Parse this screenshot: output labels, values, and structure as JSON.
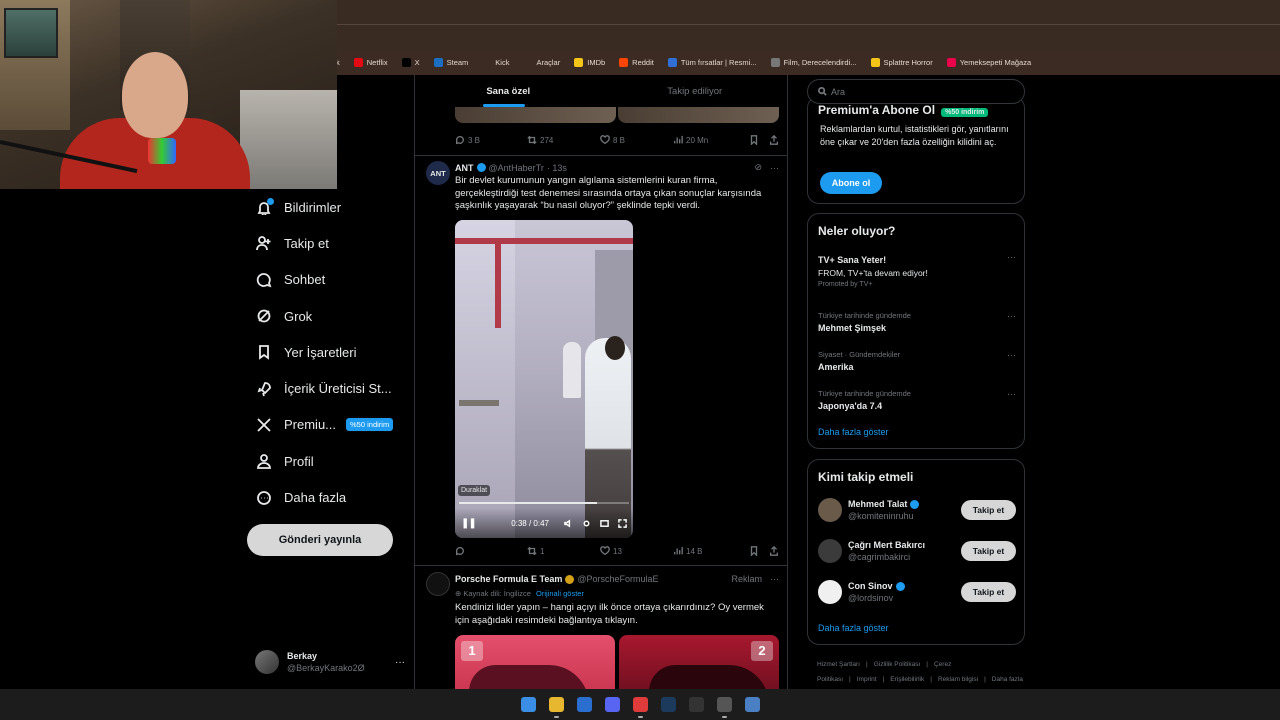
{
  "bookmarks": [
    {
      "label": "k",
      "icon": "bookmark-icon",
      "color": "#3b2b22"
    },
    {
      "label": "Netflix",
      "icon": "netflix-icon",
      "color": "#e50914"
    },
    {
      "label": "X",
      "icon": "x-icon",
      "color": "#000000"
    },
    {
      "label": "Steam",
      "icon": "steam-icon",
      "color": "#1b6ec2"
    },
    {
      "label": "Kick",
      "icon": "folder-icon",
      "color": "#3b2b22"
    },
    {
      "label": "Araçlar",
      "icon": "folder-icon",
      "color": "#3b2b22"
    },
    {
      "label": "IMDb",
      "icon": "imdb-icon",
      "color": "#f5c518"
    },
    {
      "label": "Reddit",
      "icon": "reddit-icon",
      "color": "#ff4500"
    },
    {
      "label": "Tüm fırsatlar | Resmi...",
      "icon": "store-icon",
      "color": "#2f6fd6"
    },
    {
      "label": "Film, Derecelendirdi...",
      "icon": "globe-icon",
      "color": "#777777"
    },
    {
      "label": "Splattre Horror",
      "icon": "folder-icon",
      "color": "#f5c518"
    },
    {
      "label": "Yemeksepeti Mağaza",
      "icon": "yemeksepeti-icon",
      "color": "#ea004b"
    }
  ],
  "nav": {
    "items": [
      {
        "label": "Bildirimler",
        "icon": "bell-icon"
      },
      {
        "label": "Takip et",
        "icon": "add-user-icon"
      },
      {
        "label": "Sohbet",
        "icon": "chat-icon"
      },
      {
        "label": "Grok",
        "icon": "grok-icon"
      },
      {
        "label": "Yer İşaretleri",
        "icon": "bookmark-icon"
      },
      {
        "label": "İçerik Üreticisi St...",
        "icon": "rocket-icon"
      },
      {
        "label": "Premiu...",
        "icon": "x-logo-icon",
        "badge": "%50 indirim"
      },
      {
        "label": "Profil",
        "icon": "person-icon"
      },
      {
        "label": "Daha fazla",
        "icon": "more-circle-icon"
      }
    ],
    "post_button": "Gönderi yayınla",
    "account": {
      "name": "Berkay",
      "handle": "@BerkayKarako2Ø",
      "more": "···"
    }
  },
  "tabs": [
    {
      "label": "Sana özel",
      "active": true
    },
    {
      "label": "Takip ediliyor",
      "active": false
    }
  ],
  "prev_tweet_actions": {
    "replies": "3 B",
    "reposts": "274",
    "likes": "8 B",
    "views": "20 Mn"
  },
  "tweet1": {
    "name": "ANT",
    "handle": "@AntHaberTr",
    "time": "· 13s",
    "avatar_text": "ANT",
    "text": "Bir devlet kurumunun yangın algılama sistemlerini kuran firma, gerçekleştirdiği test denemesi sırasında ortaya çıkan sonuçlar karşısında şaşkınlık yaşayarak “bu nasıl oluyor?” şeklinde tepki verdi.",
    "more": "···",
    "video": {
      "paused_label": "Duraklat",
      "time": "0:38 / 0:47",
      "progress": 0.81
    },
    "actions": {
      "replies": "",
      "reposts": "1",
      "likes": "13",
      "views": "14 B"
    }
  },
  "tweet2": {
    "name": "Porsche Formula E Team",
    "handle": "@PorscheFormulaE",
    "ad_label": "Reklam",
    "more": "···",
    "lang_note": "Kaynak dili: İngilizce",
    "lang_link": "Orijinali göster",
    "text": "Kendinizi lider yapın – hangi açıyı ilk önce ortaya çıkarırdınız? Oy vermek için aşağıdaki resimdeki bağlantıya tıklayın.",
    "images": [
      "1",
      "2"
    ]
  },
  "search": {
    "placeholder": "Ara"
  },
  "premium": {
    "title": "Premium'a Abone Ol",
    "badge": "%50 indirim",
    "text": "Reklamlardan kurtul, istatistikleri gör, yanıtlarını öne çıkar ve 20'den fazla özelliğin kilidini aç.",
    "button": "Abone ol"
  },
  "trends": {
    "title": "Neler oluyor?",
    "items": [
      {
        "category": "",
        "title": "TV+ Sana Yeter!",
        "sub": "FROM, TV+'ta devam ediyor!",
        "promo": "Promoted by TV+"
      },
      {
        "category": "Türkiye tarihinde gündemde",
        "title": "Mehmet Şimşek",
        "sub": "",
        "promo": ""
      },
      {
        "category": "Siyaset · Gündemdekiler",
        "title": "Amerika",
        "sub": "",
        "promo": ""
      },
      {
        "category": "Türkiye tarihinde gündemde",
        "title": "Japonya'da 7.4",
        "sub": "",
        "promo": ""
      }
    ],
    "more_icon": "···",
    "show_more": "Daha fazla göster"
  },
  "who_to_follow": {
    "title": "Kimi takip etmeli",
    "items": [
      {
        "name": "Mehmed Talat",
        "handle": "@komiteninruhu",
        "verified": true,
        "button": "Takip et"
      },
      {
        "name": "Çağrı Mert Bakırcı",
        "handle": "@cagrimbakirci",
        "verified": false,
        "button": "Takip et"
      },
      {
        "name": "Con Sinov",
        "handle": "@lordsinov",
        "verified": true,
        "button": "Takip et"
      }
    ],
    "show_more": "Daha fazla göster"
  },
  "footer": [
    "Hizmet Şartları",
    "|",
    "Gizlilik Politikası",
    "|",
    "Çerez Politikası",
    "|",
    "Imprint",
    "|",
    "Erişilebilirlik",
    "|",
    "Reklam bilgisi",
    "|",
    "Daha fazla ···",
    "© 2025 X Corp."
  ],
  "taskbar": [
    {
      "icon": "windows-start-icon",
      "color": "#3a8ee6"
    },
    {
      "icon": "chrome-icon",
      "color": "#e8b730"
    },
    {
      "icon": "mail-icon",
      "color": "#2a6fd0"
    },
    {
      "icon": "discord-icon",
      "color": "#5865f2"
    },
    {
      "icon": "media-player-icon",
      "color": "#e03b3b"
    },
    {
      "icon": "steam-icon",
      "color": "#1b3a5c"
    },
    {
      "icon": "epic-games-icon",
      "color": "#333333"
    },
    {
      "icon": "obs-icon",
      "color": "#555555"
    },
    {
      "icon": "notepad-icon",
      "color": "#4a7fc4"
    }
  ]
}
